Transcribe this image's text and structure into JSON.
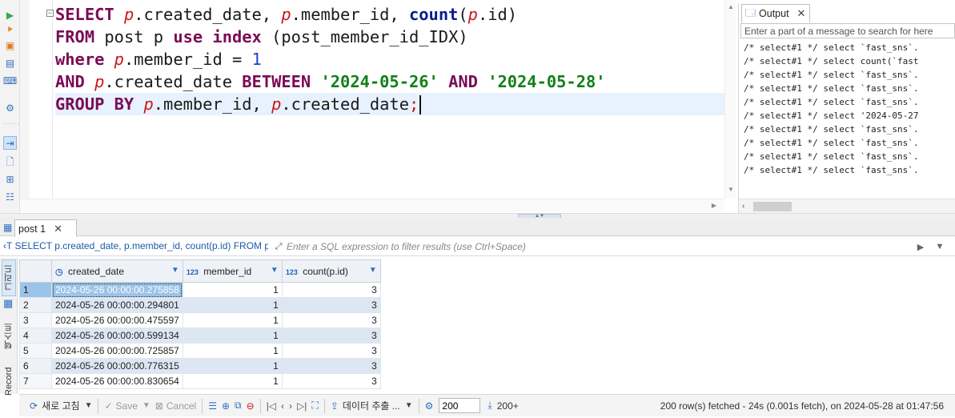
{
  "editor": {
    "lines": [
      [
        {
          "t": "SELECT ",
          "c": "kw"
        },
        {
          "t": "p",
          "c": "al"
        },
        {
          "t": ".created_date, ",
          "c": "pl"
        },
        {
          "t": "p",
          "c": "al"
        },
        {
          "t": ".member_id, ",
          "c": "pl"
        },
        {
          "t": "count",
          "c": "fn"
        },
        {
          "t": "(",
          "c": "pl"
        },
        {
          "t": "p",
          "c": "al"
        },
        {
          "t": ".id)",
          "c": "pl"
        }
      ],
      [
        {
          "t": "FROM ",
          "c": "kw"
        },
        {
          "t": "post p ",
          "c": "pl"
        },
        {
          "t": "use index ",
          "c": "kw"
        },
        {
          "t": "(post_member_id_IDX)",
          "c": "pl"
        }
      ],
      [
        {
          "t": "where ",
          "c": "kw"
        },
        {
          "t": "p",
          "c": "al"
        },
        {
          "t": ".member_id = ",
          "c": "pl"
        },
        {
          "t": "1",
          "c": "nm"
        }
      ],
      [
        {
          "t": "AND ",
          "c": "kw"
        },
        {
          "t": "p",
          "c": "al"
        },
        {
          "t": ".created_date ",
          "c": "pl"
        },
        {
          "t": "BETWEEN ",
          "c": "kw"
        },
        {
          "t": "'2024-05-26'",
          "c": "st"
        },
        {
          "t": " AND ",
          "c": "kw"
        },
        {
          "t": "'2024-05-28'",
          "c": "st"
        }
      ],
      [
        {
          "t": "GROUP BY ",
          "c": "kw"
        },
        {
          "t": "p",
          "c": "al"
        },
        {
          "t": ".member_id, ",
          "c": "pl"
        },
        {
          "t": "p",
          "c": "al"
        },
        {
          "t": ".created_date",
          "c": "pl"
        },
        {
          "t": ";",
          "c": "sm"
        }
      ]
    ]
  },
  "output": {
    "tab_label": "Output",
    "search_placeholder": "Enter a part of a message to search for here",
    "log_lines": [
      "/* select#1 */ select `fast_sns`.",
      "/* select#1 */ select count(`fast",
      "/* select#1 */ select `fast_sns`.",
      "/* select#1 */ select `fast_sns`.",
      "/* select#1 */ select `fast_sns`.",
      "/* select#1 */ select '2024-05-27",
      "/* select#1 */ select `fast_sns`.",
      "/* select#1 */ select `fast_sns`.",
      "/* select#1 */ select `fast_sns`.",
      "/* select#1 */ select `fast_sns`."
    ]
  },
  "results": {
    "tab_label": "post 1",
    "query_summary": "‹T SELECT p.created_date, p.member_id, count(p.id) FROM post",
    "filter_placeholder": "Enter a SQL expression to filter results (use Ctrl+Space)",
    "side_tabs": {
      "grid": "그리드",
      "text": "텍스트",
      "record": "Record"
    },
    "columns": [
      {
        "icon": "clock-icon",
        "label": "created_date"
      },
      {
        "icon": "123",
        "label": "member_id"
      },
      {
        "icon": "123",
        "label": "count(p.id)"
      }
    ],
    "rows": [
      {
        "n": "1",
        "created_date": "2024-05-26 00:00:00.275858",
        "member_id": "1",
        "count": "3"
      },
      {
        "n": "2",
        "created_date": "2024-05-26 00:00:00.294801",
        "member_id": "1",
        "count": "3"
      },
      {
        "n": "3",
        "created_date": "2024-05-26 00:00:00.475597",
        "member_id": "1",
        "count": "3"
      },
      {
        "n": "4",
        "created_date": "2024-05-26 00:00:00.599134",
        "member_id": "1",
        "count": "3"
      },
      {
        "n": "5",
        "created_date": "2024-05-26 00:00:00.725857",
        "member_id": "1",
        "count": "3"
      },
      {
        "n": "6",
        "created_date": "2024-05-26 00:00:00.776315",
        "member_id": "1",
        "count": "3"
      },
      {
        "n": "7",
        "created_date": "2024-05-26 00:00:00.830654",
        "member_id": "1",
        "count": "3"
      }
    ]
  },
  "toolbar": {
    "refresh_label": "새로 고침",
    "save_label": "Save",
    "cancel_label": "Cancel",
    "export_label": "데이터 추출 ...",
    "fetch_size": "200",
    "fetch_more_label": "200+",
    "status": "200 row(s) fetched - 24s (0.001s fetch), on 2024-05-28 at 01:47:56"
  },
  "colors": {
    "keyword": "#7a0b55",
    "function": "#0b1d8c",
    "alias": "#c9161b",
    "string": "#13801a",
    "number": "#1f3fd8",
    "selection": "#9cc3e8",
    "accent": "#2f6fc0"
  }
}
